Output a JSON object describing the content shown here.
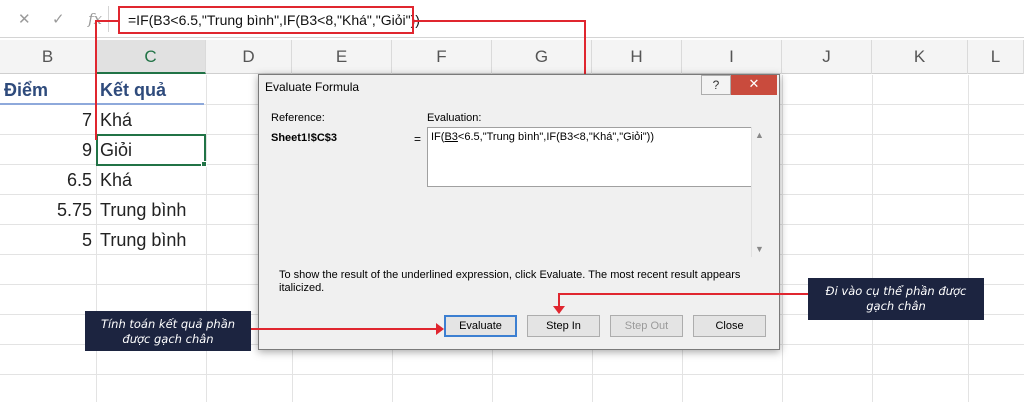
{
  "formula_bar": {
    "cancel_icon": "x-icon",
    "confirm_icon": "check-icon",
    "fx_label": "fx",
    "formula": "=IF(B3<6.5,\"Trung bình\",IF(B3<8,\"Khá\",\"Giỏi\"))"
  },
  "columns": [
    "B",
    "C",
    "D",
    "E",
    "F",
    "G",
    "H",
    "I",
    "J",
    "K",
    "L"
  ],
  "sheet": {
    "header_b": "Điểm",
    "header_c": "Kết quả",
    "rows": [
      {
        "score": "7",
        "result": "Khá"
      },
      {
        "score": "9",
        "result": "Giỏi"
      },
      {
        "score": "6.5",
        "result": "Khá"
      },
      {
        "score": "5.75",
        "result": "Trung bình"
      },
      {
        "score": "5",
        "result": "Trung bình"
      }
    ]
  },
  "dialog": {
    "title": "Evaluate Formula",
    "help_label": "?",
    "close_label": "✕",
    "reference_label": "Reference:",
    "reference_value": "Sheet1!$C$3",
    "equals": "=",
    "evaluation_label": "Evaluation:",
    "evaluation_prefix": "IF(",
    "evaluation_underlined": "B3",
    "evaluation_rest": "<6.5,\"Trung bình\",IF(B3<8,\"Khá\",\"Giỏi\"))",
    "info_text": "To show the result of the underlined expression, click Evaluate.  The most recent result appears italicized.",
    "buttons": {
      "evaluate": "Evaluate",
      "step_in": "Step In",
      "step_out": "Step Out",
      "close": "Close"
    }
  },
  "callouts": {
    "evaluate_note": "Tính toán kết quả phần được gạch chân",
    "step_in_note": "Đi vào cụ thể phần được gạch chân"
  },
  "colors": {
    "highlight": "#e0262f",
    "selection": "#217346",
    "callout_bg": "#1c2440"
  }
}
